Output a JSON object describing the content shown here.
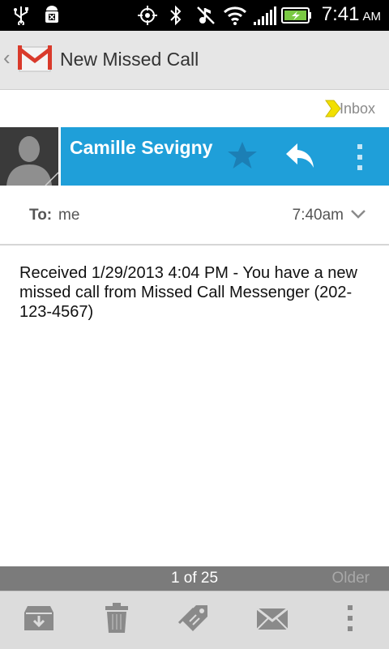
{
  "status_bar": {
    "time": "7:41",
    "ampm": "AM",
    "icons": [
      "usb-icon",
      "android-debug-icon",
      "gps-icon",
      "bluetooth-icon",
      "mute-icon",
      "wifi-icon",
      "signal-icon",
      "battery-charging-icon"
    ]
  },
  "app_bar": {
    "title": "New Missed Call",
    "app_icon": "gmail-icon"
  },
  "label": {
    "text": "Inbox",
    "color": "#f2e000"
  },
  "sender": {
    "name": "Camille Sevigny",
    "accent": "#1f9fd9"
  },
  "recipient": {
    "label": "To:",
    "value": "me",
    "time": "7:40am"
  },
  "message": {
    "body": "Received 1/29/2013 4:04 PM - You have a new missed call from Missed Call Messenger (202-123-4567)"
  },
  "pager": {
    "position": "1 of 25",
    "older": "Older"
  },
  "toolbar": {
    "buttons": [
      "archive-icon",
      "delete-icon",
      "labels-icon",
      "mark-unread-icon",
      "overflow-menu-icon"
    ]
  }
}
